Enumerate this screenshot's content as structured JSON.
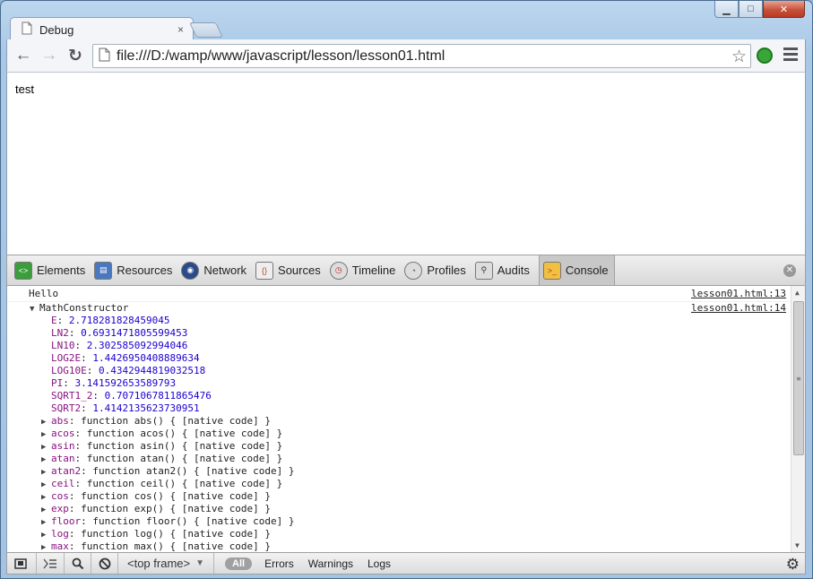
{
  "window": {
    "minimize": "▁",
    "maximize": "□",
    "close": "✕"
  },
  "tab": {
    "title": "Debug",
    "close": "×"
  },
  "toolbar": {
    "back": "←",
    "forward": "→",
    "reload": "↻",
    "url": "file:///D:/wamp/www/javascript/lesson/lesson01.html"
  },
  "page": {
    "text": "test"
  },
  "devtools": {
    "tabs": [
      {
        "label": "Elements",
        "icon": "elements-icon",
        "color": "#3b9d3b"
      },
      {
        "label": "Resources",
        "icon": "resources-icon",
        "color": "#4a78c0"
      },
      {
        "label": "Network",
        "icon": "network-icon",
        "color": "#2a4a8a"
      },
      {
        "label": "Sources",
        "icon": "sources-icon",
        "color": "#c04a2a"
      },
      {
        "label": "Timeline",
        "icon": "timeline-icon",
        "color": "#c03030"
      },
      {
        "label": "Profiles",
        "icon": "profiles-icon",
        "color": "#8a8a8a"
      },
      {
        "label": "Audits",
        "icon": "audits-icon",
        "color": "#5a5a5a"
      },
      {
        "label": "Console",
        "icon": "console-icon",
        "color": "#e0a020"
      }
    ]
  },
  "console": {
    "messages": [
      {
        "text": "Hello",
        "source": "lesson01.html:13"
      },
      {
        "text": "MathConstructor",
        "source": "lesson01.html:14"
      }
    ],
    "constants": [
      {
        "key": "E",
        "value": "2.718281828459045"
      },
      {
        "key": "LN2",
        "value": "0.6931471805599453"
      },
      {
        "key": "LN10",
        "value": "2.302585092994046"
      },
      {
        "key": "LOG2E",
        "value": "1.4426950408889634"
      },
      {
        "key": "LOG10E",
        "value": "0.4342944819032518"
      },
      {
        "key": "PI",
        "value": "3.141592653589793"
      },
      {
        "key": "SQRT1_2",
        "value": "0.7071067811865476"
      },
      {
        "key": "SQRT2",
        "value": "1.4142135623730951"
      }
    ],
    "functions": [
      {
        "key": "abs",
        "value": "function abs() { [native code] }"
      },
      {
        "key": "acos",
        "value": "function acos() { [native code] }"
      },
      {
        "key": "asin",
        "value": "function asin() { [native code] }"
      },
      {
        "key": "atan",
        "value": "function atan() { [native code] }"
      },
      {
        "key": "atan2",
        "value": "function atan2() { [native code] }"
      },
      {
        "key": "ceil",
        "value": "function ceil() { [native code] }"
      },
      {
        "key": "cos",
        "value": "function cos() { [native code] }"
      },
      {
        "key": "exp",
        "value": "function exp() { [native code] }"
      },
      {
        "key": "floor",
        "value": "function floor() { [native code] }"
      },
      {
        "key": "log",
        "value": "function log() { [native code] }"
      },
      {
        "key": "max",
        "value": "function max() { [native code] }"
      }
    ]
  },
  "statusbar": {
    "frame": "<top frame>",
    "filters": [
      "All",
      "Errors",
      "Warnings",
      "Logs"
    ]
  }
}
